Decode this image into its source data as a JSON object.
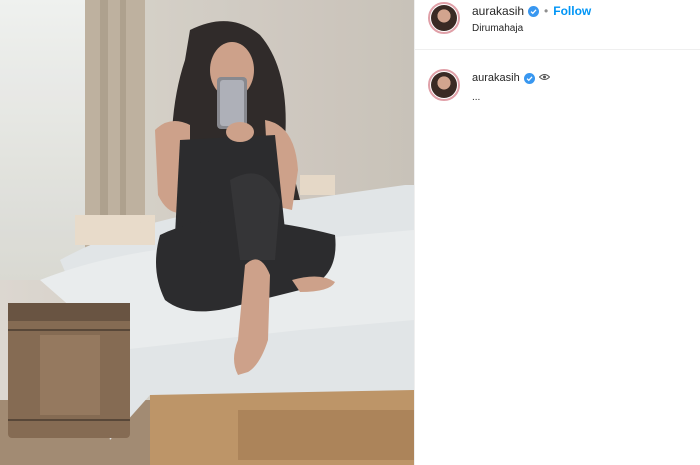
{
  "post": {
    "username": "aurakasih",
    "follow_label": "Follow",
    "location": "Dirumahaja",
    "dot": "•"
  },
  "comment": {
    "username": "aurakasih",
    "caption": "..."
  },
  "icons": {
    "verified": "verified-badge-icon",
    "eye": "eye-icon"
  },
  "colors": {
    "follow": "#0095f6",
    "verified": "#3897f0"
  }
}
